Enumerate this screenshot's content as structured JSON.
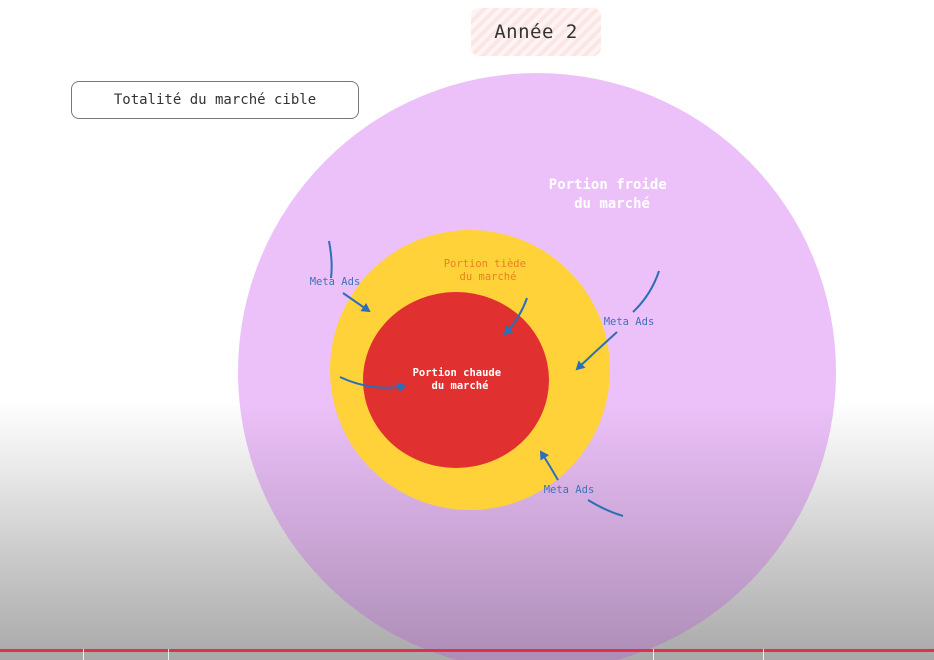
{
  "header": {
    "year_label": "Année 2"
  },
  "market_box": {
    "label": "Totalité du marché cible"
  },
  "diagram": {
    "cold": {
      "line1": "Portion froide",
      "line2": "du marché",
      "color": "#ecc1f9"
    },
    "warm": {
      "line1": "Portion tiède",
      "line2": "du marché",
      "color": "#ffd23a"
    },
    "hot": {
      "line1": "Portion chaude",
      "line2": "du marché",
      "color": "#e0302f"
    },
    "ads_label": "Meta Ads",
    "arrow_color": "#2b6fb6",
    "label_blue": "#3f72b9",
    "label_orange": "#e8801e"
  }
}
